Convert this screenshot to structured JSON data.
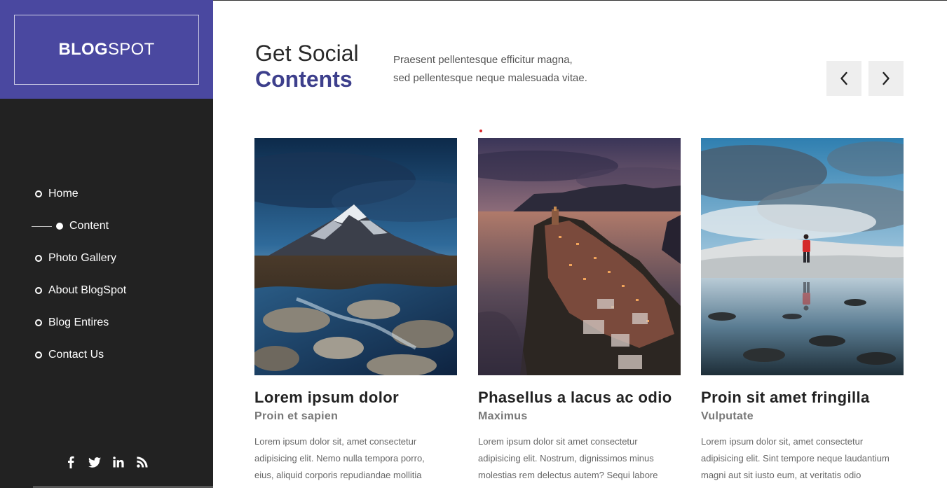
{
  "brand": {
    "bold": "BLOG",
    "light": "SPOT"
  },
  "nav": [
    {
      "label": "Home",
      "active": false
    },
    {
      "label": "Content",
      "active": true
    },
    {
      "label": "Photo Gallery",
      "active": false
    },
    {
      "label": "About BlogSpot",
      "active": false
    },
    {
      "label": "Blog Entires",
      "active": false
    },
    {
      "label": "Contact Us",
      "active": false
    }
  ],
  "social": [
    "facebook-icon",
    "twitter-icon",
    "linkedin-icon",
    "rss-icon"
  ],
  "section": {
    "title_line1": "Get Social",
    "title_line2": "Contents",
    "desc_line1": "Praesent pellentesque efficitur magna,",
    "desc_line2": "sed pellentesque neque malesuada vitae."
  },
  "carousel": {
    "prev": "‹",
    "next": "›"
  },
  "cards": [
    {
      "title": "Lorem ipsum dolor",
      "subtitle": "Proin et sapien",
      "text": [
        "Lorem ipsum dolor sit, amet consectetur",
        "adipisicing elit. Nemo nulla tempora porro,",
        "eius, aliquid corporis repudiandae mollitia"
      ],
      "image": "mountain-river-photo"
    },
    {
      "title": "Phasellus a lacus ac odio",
      "subtitle": "Maximus",
      "text": [
        "Lorem ipsum dolor sit amet consectetur",
        "adipisicing elit. Nostrum, dignissimos minus",
        "molestias rem delectus autem? Sequi labore"
      ],
      "image": "coastal-village-sunset-photo"
    },
    {
      "title": "Proin sit amet fringilla",
      "subtitle": "Vulputate",
      "text": [
        "Lorem ipsum dolor sit, amet consectetur",
        "adipisicing elit. Sint tempore neque laudantium",
        "magni aut sit iusto eum, at veritatis odio"
      ],
      "image": "hiker-reflection-photo"
    }
  ],
  "colors": {
    "brand": "#4a48a0",
    "sidebar": "#222222",
    "accent_title": "#3d3f8c",
    "arrow_bg": "#eeeeee"
  }
}
